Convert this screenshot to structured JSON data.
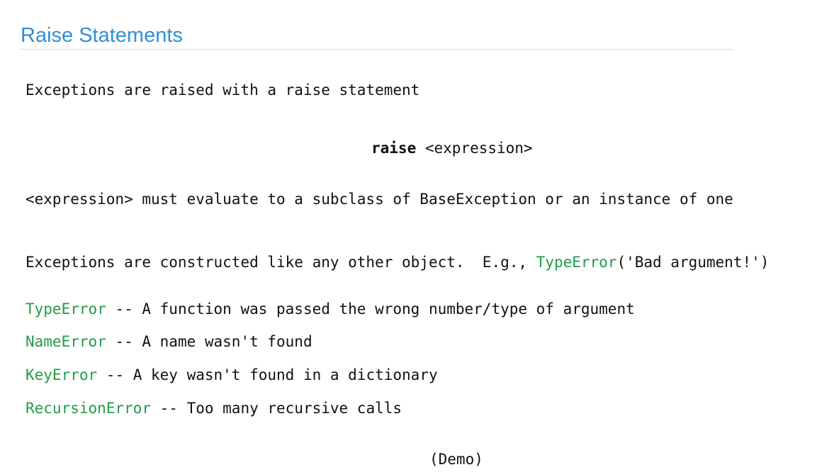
{
  "slide": {
    "title": "Raise Statements",
    "intro": "Exceptions are raised with a raise statement",
    "syntax": {
      "keyword": "raise",
      "argument": " <expression>"
    },
    "requirement": "<expression> must evaluate to a subclass of BaseException or an instance of one",
    "construction": {
      "text": "Exceptions are constructed like any other object.  E.g., ",
      "example_name": "TypeError",
      "example_args": "('Bad argument!')"
    },
    "errors": [
      {
        "name": "TypeError",
        "description": " -- A function was passed the wrong number/type of argument"
      },
      {
        "name": "NameError",
        "description": " -- A name wasn't found"
      },
      {
        "name": "KeyError",
        "description": " -- A key wasn't found in a dictionary"
      },
      {
        "name": "RecursionError",
        "description": " -- Too many recursive calls"
      }
    ],
    "footer": "(Demo)"
  },
  "colors": {
    "title": "#2f8fd6",
    "error_name": "#249a49",
    "text": "#111111"
  }
}
